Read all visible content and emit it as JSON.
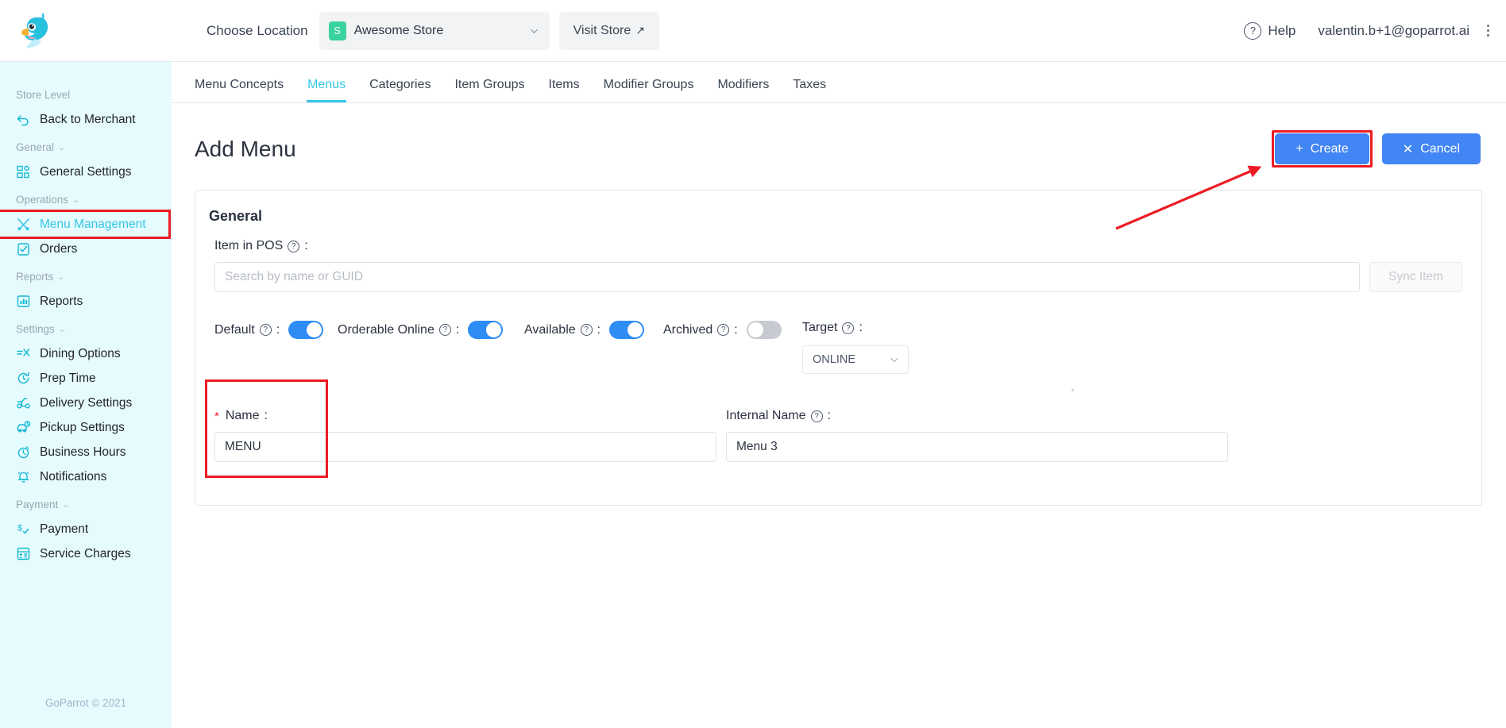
{
  "header": {
    "logo_icon": "parrot-logo-icon",
    "choose_location_label": "Choose Location",
    "store_badge_letter": "S",
    "store_name": "Awesome Store",
    "visit_store_label": "Visit Store",
    "visit_store_arrow": "↗",
    "help_label": "Help",
    "help_icon": "question-circle-icon",
    "user_email": "valentin.b+1@goparrot.ai",
    "overflow_icon": "kebab-menu-icon"
  },
  "sidebar": {
    "groups": [
      {
        "label": "Store Level",
        "has_chevron": false,
        "items": [
          {
            "label": "Back to Merchant",
            "icon": "back-arrow-icon",
            "active": false,
            "highlighted": false
          }
        ]
      },
      {
        "label": "General",
        "has_chevron": true,
        "items": [
          {
            "label": "General Settings",
            "icon": "grid-squares-icon",
            "active": false,
            "highlighted": false
          }
        ]
      },
      {
        "label": "Operations",
        "has_chevron": true,
        "items": [
          {
            "label": "Menu Management",
            "icon": "fork-knife-icon",
            "active": true,
            "highlighted": true
          },
          {
            "label": "Orders",
            "icon": "clipboard-check-icon",
            "active": false,
            "highlighted": false
          }
        ]
      },
      {
        "label": "Reports",
        "has_chevron": true,
        "items": [
          {
            "label": "Reports",
            "icon": "bar-chart-icon",
            "active": false,
            "highlighted": false
          }
        ]
      },
      {
        "label": "Settings",
        "has_chevron": true,
        "items": [
          {
            "label": "Dining Options",
            "icon": "dining-options-icon",
            "active": false,
            "highlighted": false
          },
          {
            "label": "Prep Time",
            "icon": "clock-refresh-icon",
            "active": false,
            "highlighted": false
          },
          {
            "label": "Delivery Settings",
            "icon": "scooter-icon",
            "active": false,
            "highlighted": false
          },
          {
            "label": "Pickup Settings",
            "icon": "car-clock-icon",
            "active": false,
            "highlighted": false
          },
          {
            "label": "Business Hours",
            "icon": "stopwatch-icon",
            "active": false,
            "highlighted": false
          },
          {
            "label": "Notifications",
            "icon": "bell-icon",
            "active": false,
            "highlighted": false
          }
        ]
      },
      {
        "label": "Payment",
        "has_chevron": true,
        "items": [
          {
            "label": "Payment",
            "icon": "dollar-check-icon",
            "active": false,
            "highlighted": false
          },
          {
            "label": "Service Charges",
            "icon": "calculator-icon",
            "active": false,
            "highlighted": false
          }
        ]
      }
    ],
    "footer": "GoParrot © 2021"
  },
  "tabs": [
    {
      "label": "Menu Concepts",
      "active": false
    },
    {
      "label": "Menus",
      "active": true
    },
    {
      "label": "Categories",
      "active": false
    },
    {
      "label": "Item Groups",
      "active": false
    },
    {
      "label": "Items",
      "active": false
    },
    {
      "label": "Modifier Groups",
      "active": false
    },
    {
      "label": "Modifiers",
      "active": false
    },
    {
      "label": "Taxes",
      "active": false
    }
  ],
  "page": {
    "title": "Add Menu",
    "create_label": "Create",
    "create_icon": "plus-icon",
    "cancel_label": "Cancel",
    "cancel_icon": "close-x-icon"
  },
  "form": {
    "section_title": "General",
    "item_in_pos": {
      "label": "Item in POS",
      "help_icon": "question-circle-icon",
      "colon": ":",
      "search_placeholder": "Search by name or GUID",
      "search_value": "",
      "sync_button_label": "Sync Item"
    },
    "toggles": [
      {
        "label": "Default",
        "help_icon": "question-circle-icon",
        "colon": ":",
        "on": true
      },
      {
        "label": "Orderable Online",
        "help_icon": "question-circle-icon",
        "colon": ":",
        "on": true
      },
      {
        "label": "Available",
        "help_icon": "question-circle-icon",
        "colon": ":",
        "on": true
      },
      {
        "label": "Archived",
        "help_icon": "question-circle-icon",
        "colon": ":",
        "on": false
      }
    ],
    "target": {
      "label": "Target",
      "help_icon": "question-circle-icon",
      "colon": ":",
      "value": "ONLINE",
      "caret_icon": "chevron-down-icon"
    },
    "name": {
      "required_marker": "*",
      "label": "Name",
      "colon": ":",
      "value": "MENU"
    },
    "internal_name": {
      "label": "Internal Name",
      "help_icon": "question-circle-icon",
      "colon": ":",
      "value": "Menu 3"
    }
  },
  "annotations": {
    "highlight_color": "#ec1c24",
    "arrow_icon": "red-arrow-annotation"
  },
  "colors": {
    "sidebar_bg": "#e6fbfd",
    "accent_cyan": "#35c6e8",
    "primary_blue": "#4285f4",
    "toggle_on": "#2e8cf5",
    "toggle_off": "#c7cbd1",
    "badge_green": "#3ad29f"
  }
}
